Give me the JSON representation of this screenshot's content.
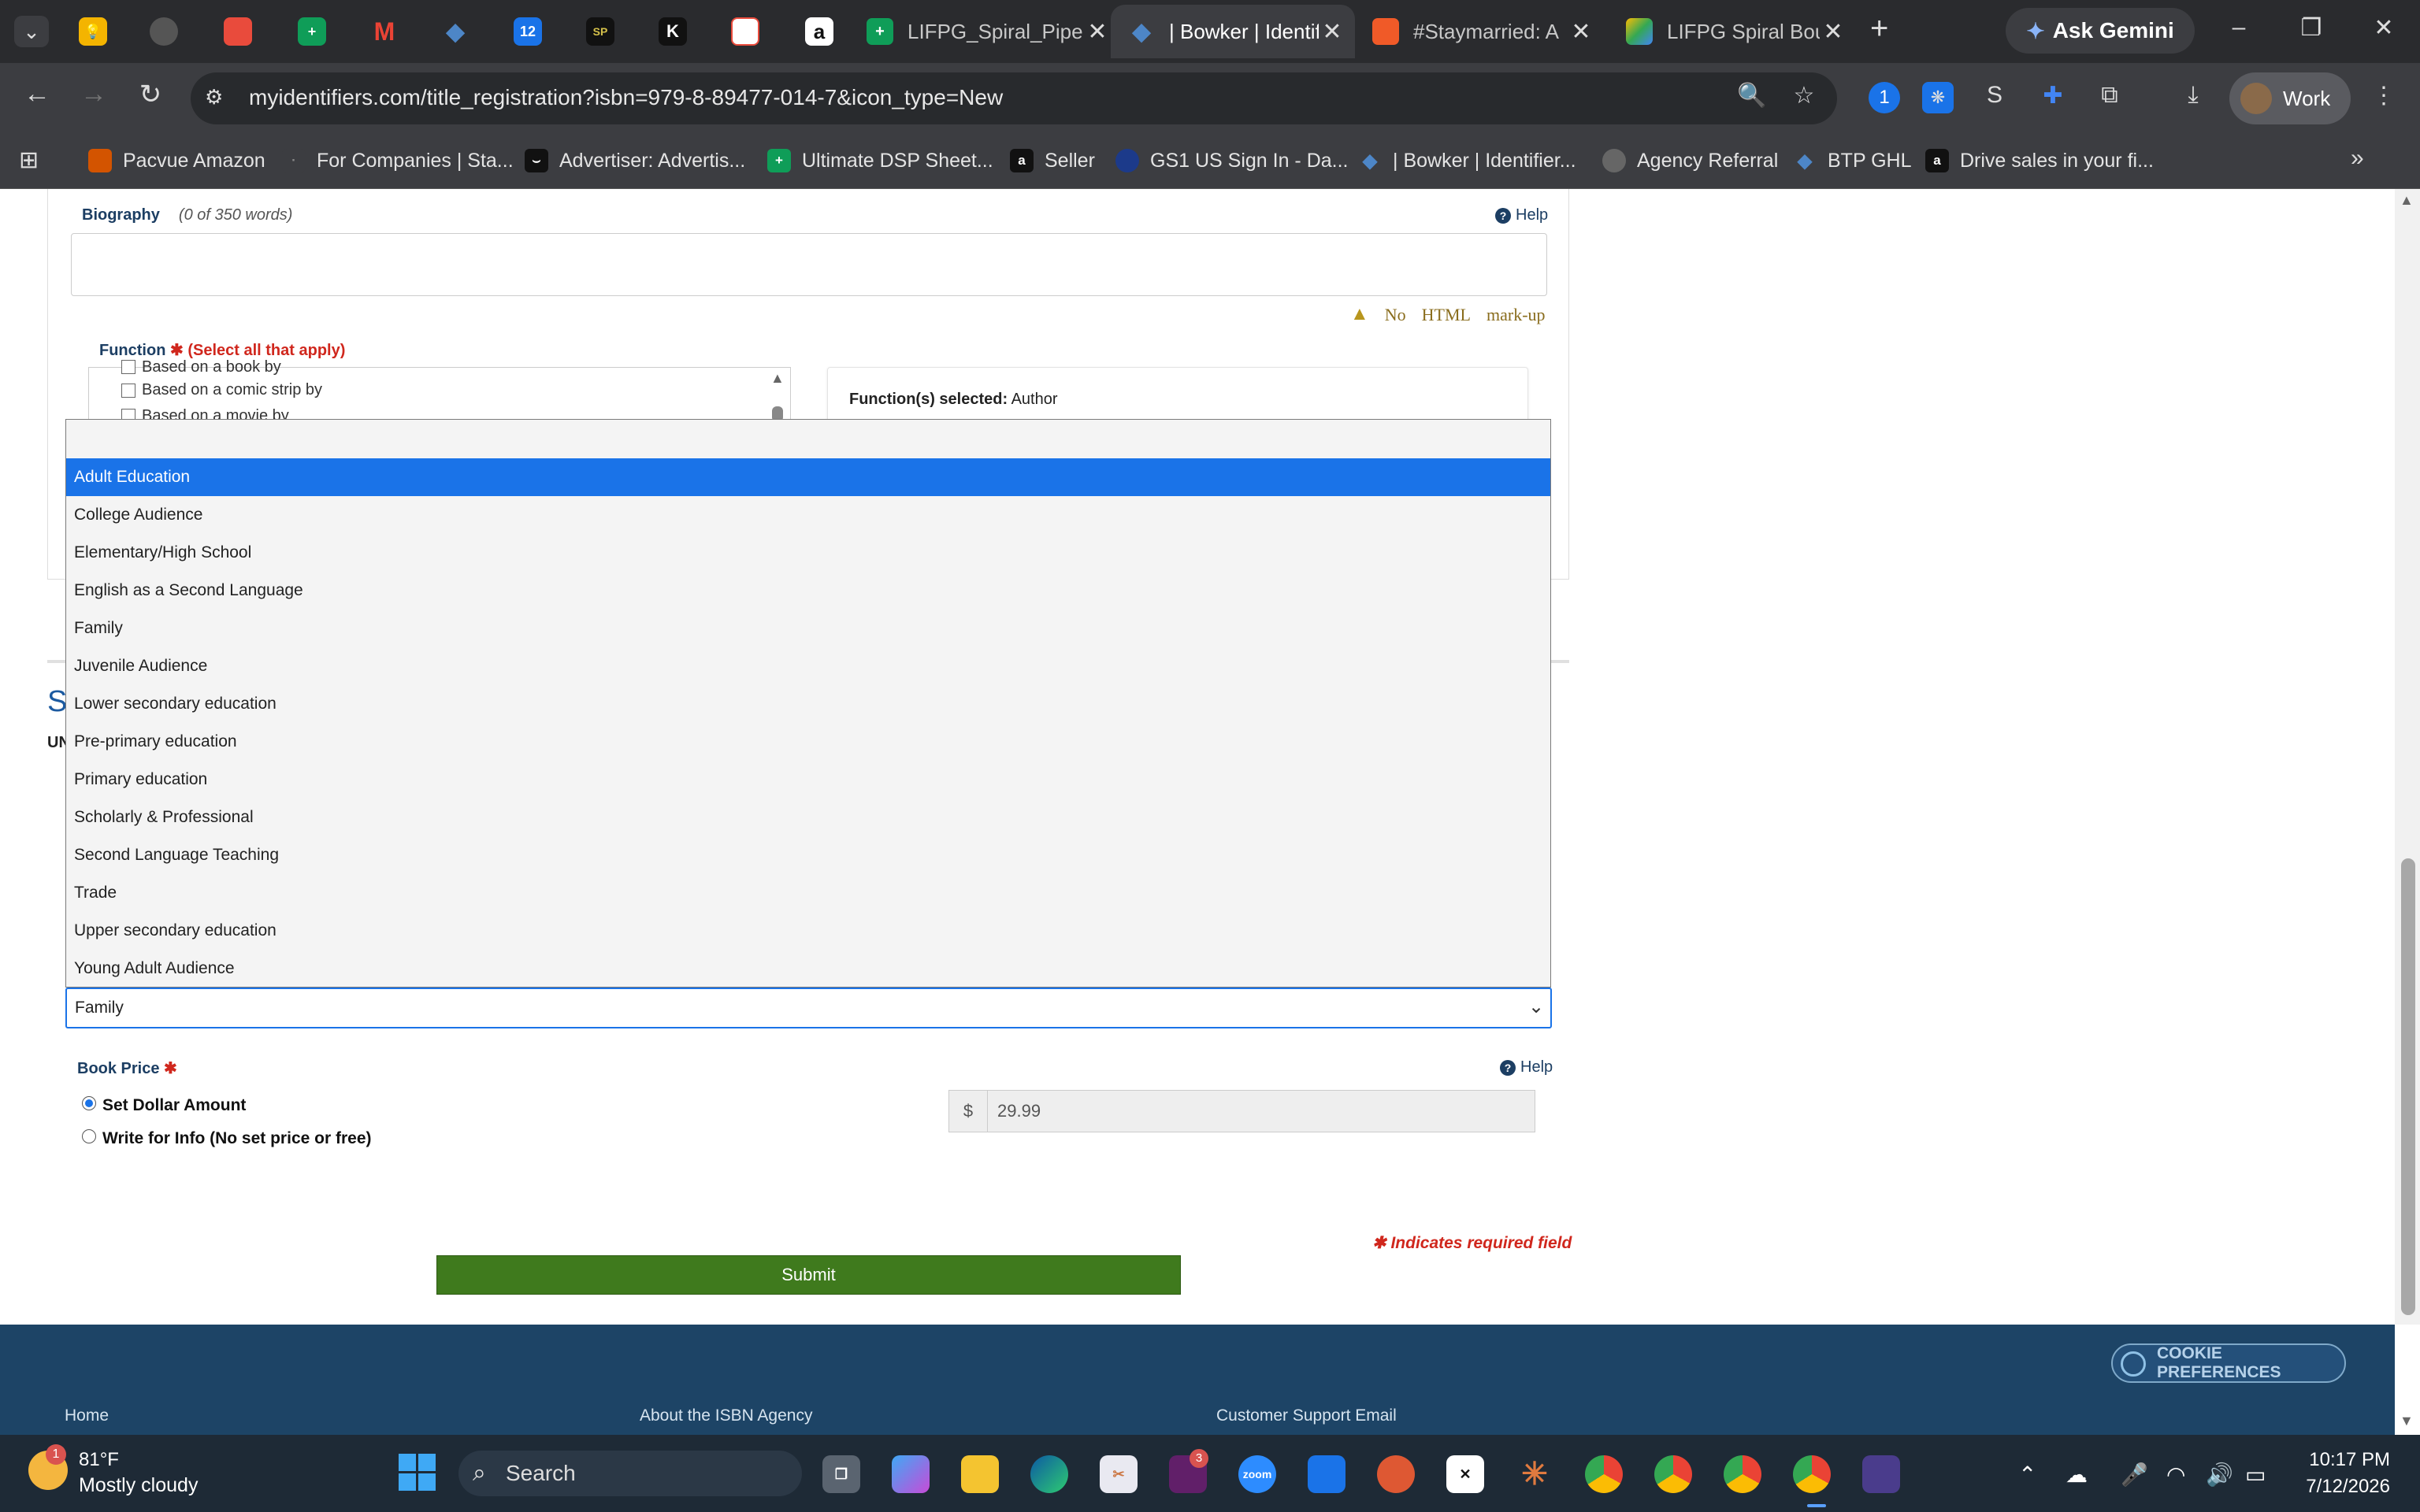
{
  "browser": {
    "tabs": [
      {
        "title": "LIFPG_Spiral_Pipe",
        "active": false
      },
      {
        "title": "| Bowker | Identif",
        "active": true
      },
      {
        "title": "#Staymarried: A",
        "active": false
      },
      {
        "title": "LIFPG Spiral Bou",
        "active": false
      }
    ],
    "pinned_tab_labels": [
      "12",
      "SP",
      "K"
    ],
    "gemini_label": "Ask Gemini",
    "url": "myidentifiers.com/title_registration?isbn=979-8-89477-014-7&icon_type=New",
    "profile_label": "Work",
    "bookmarks": [
      "Pacvue Amazon",
      "For Companies | Sta...",
      "Advertiser: Advertis...",
      "Ultimate DSP Sheet...",
      "Seller",
      "GS1 US Sign In - Da...",
      "| Bowker | Identifier...",
      "Agency Referral",
      "BTP GHL",
      "Drive sales in your fi..."
    ]
  },
  "form": {
    "biography_label": "Biography",
    "biography_hint": "(0 of 350 words)",
    "help_label": "Help",
    "no_html_words": [
      "No",
      "HTML",
      "mark-up"
    ],
    "function_label": "Function",
    "function_required_hint": "(Select all that apply)",
    "function_items": [
      "Based on a book by",
      "Based on a comic strip by",
      "Based on a movie by"
    ],
    "functions_selected_label": "Function(s) selected:",
    "functions_selected_value": "Author",
    "section_fragment": "S",
    "section_fragment2": "UN",
    "audience_options": [
      "Adult Education",
      "College Audience",
      "Elementary/High School",
      "English as a Second Language",
      "Family",
      "Juvenile Audience",
      "Lower secondary education",
      "Pre-primary education",
      "Primary education",
      "Scholarly & Professional",
      "Second Language Teaching",
      "Trade",
      "Upper secondary education",
      "Young Adult Audience"
    ],
    "highlighted_option": "Adult Education",
    "audience_selected": "Family",
    "book_price_label": "Book Price",
    "price_option_set": "Set Dollar Amount",
    "price_option_wfi": "Write for Info (No set price or free)",
    "currency_symbol": "$",
    "price_value": "29.99",
    "required_note": "Indicates required field",
    "submit_label": "Submit"
  },
  "footer": {
    "cookie_label": "COOKIE PREFERENCES",
    "links": [
      "Home",
      "About the ISBN Agency",
      "Customer Support Email"
    ]
  },
  "taskbar": {
    "weather_badge": "1",
    "temperature": "81°F",
    "weather_desc": "Mostly cloudy",
    "search_label": "Search",
    "slack_badge": "3",
    "zoom_label": "zoom",
    "time": "10:17 PM",
    "date": "7/12/2026"
  },
  "colors": {
    "accent_blue": "#1a73e8",
    "submit_green": "#3f7a1d",
    "required_red": "#d0271d",
    "footer_navy": "#1d4466",
    "label_navy": "#1c3e63"
  }
}
